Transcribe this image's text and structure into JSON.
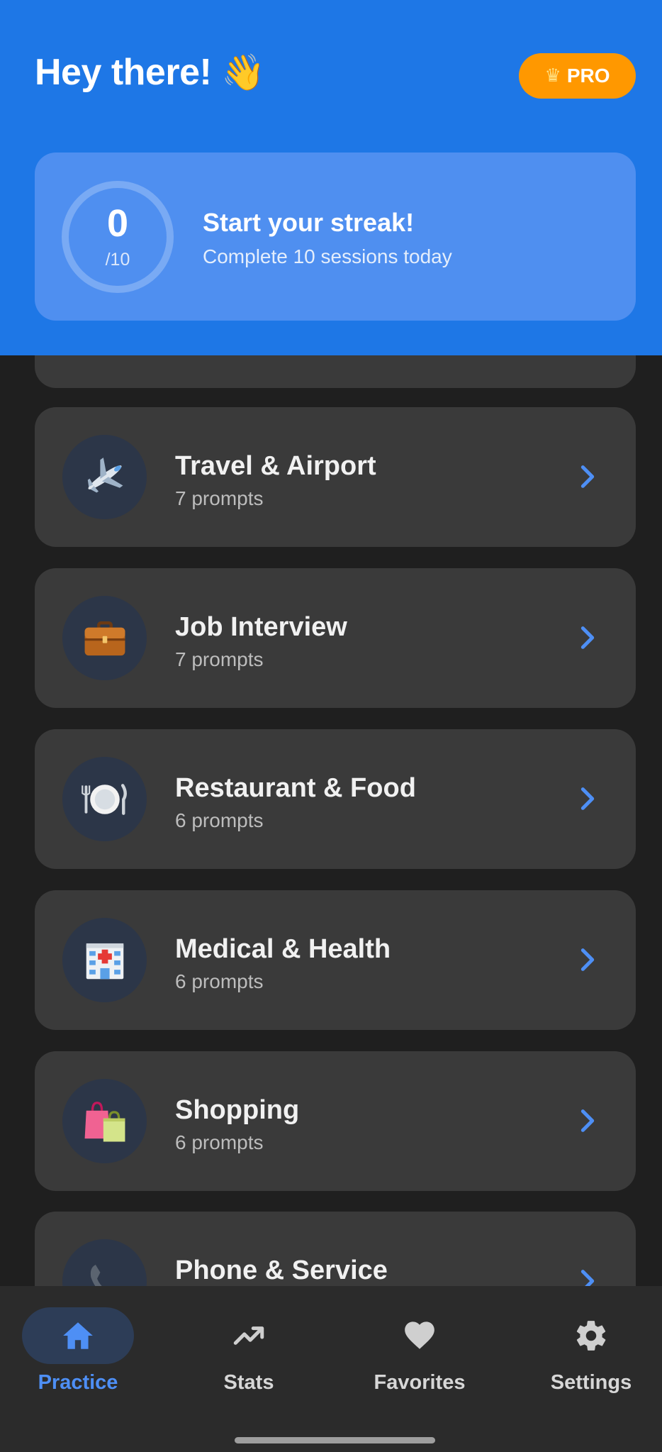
{
  "header": {
    "greeting": "Hey there!",
    "greeting_emoji": "👋",
    "pro_badge": {
      "icon": "crown-icon",
      "glyph": "♛",
      "label": "PRO"
    },
    "streak": {
      "count": "0",
      "total": "/10",
      "title": "Start your streak!",
      "subtitle": "Complete 10 sessions today"
    }
  },
  "categories": [
    {
      "title": "Travel & Airport",
      "count": "7 prompts",
      "icon": "airplane-icon"
    },
    {
      "title": "Job Interview",
      "count": "7 prompts",
      "icon": "briefcase-icon"
    },
    {
      "title": "Restaurant & Food",
      "count": "6 prompts",
      "icon": "plate-icon"
    },
    {
      "title": "Medical & Health",
      "count": "6 prompts",
      "icon": "hospital-icon"
    },
    {
      "title": "Shopping",
      "count": "6 prompts",
      "icon": "shopping-bags-icon"
    },
    {
      "title": "Phone & Service",
      "count": "",
      "icon": "phone-icon"
    }
  ],
  "nav": {
    "items": [
      {
        "label": "Practice",
        "icon": "home-icon",
        "active": true
      },
      {
        "label": "Stats",
        "icon": "trending-up-icon",
        "active": false
      },
      {
        "label": "Favorites",
        "icon": "heart-icon",
        "active": false
      },
      {
        "label": "Settings",
        "icon": "gear-icon",
        "active": false
      }
    ]
  },
  "colors": {
    "header_bg": "#1e77e6",
    "accent": "#4e8ff5",
    "pro_badge": "#ff9800",
    "card_bg": "#3a3a3a",
    "page_bg": "#1f1f1f"
  }
}
